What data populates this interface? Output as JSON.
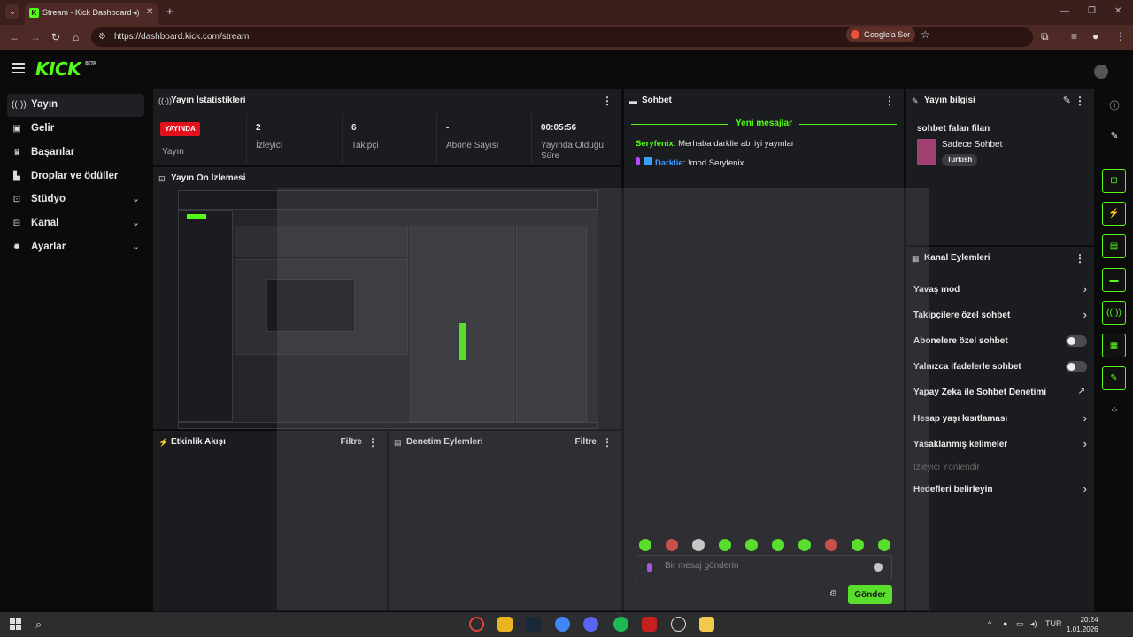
{
  "browser": {
    "tab_title": "Stream - Kick Dashboard",
    "url": "https://dashboard.kick.com/stream",
    "google_ask": "Google'a Sor"
  },
  "header": {
    "logo": "KICK",
    "logo_badge": "BETA"
  },
  "sidebar": {
    "items": [
      {
        "label": "Yayın",
        "icon": "broadcast-icon"
      },
      {
        "label": "Gelir",
        "icon": "revenue-icon"
      },
      {
        "label": "Başarılar",
        "icon": "trophy-icon"
      },
      {
        "label": "Droplar ve ödüller",
        "icon": "drops-icon"
      },
      {
        "label": "Stüdyo",
        "icon": "studio-icon"
      },
      {
        "label": "Kanal",
        "icon": "channel-icon"
      },
      {
        "label": "Ayarlar",
        "icon": "gear-icon"
      }
    ]
  },
  "stats": {
    "title": "Yayın İstatistikleri",
    "live_badge": "YAYINDA",
    "stream_label": "Yayın",
    "viewers_value": "2",
    "viewers_label": "İzleyici",
    "followers_value": "6",
    "followers_label": "Takipçi",
    "subs_value": "-",
    "subs_label": "Abone Sayısı",
    "duration_value": "00:05:56",
    "duration_label": "Yayında Olduğu Süre"
  },
  "preview": {
    "title": "Yayın Ön İzlemesi"
  },
  "activity": {
    "title": "Etkinlik Akışı",
    "filter": "Filtre"
  },
  "moderation": {
    "title": "Denetim Eylemleri",
    "filter": "Filtre"
  },
  "chat": {
    "title": "Sohbet",
    "new_messages": "Yeni mesajlar",
    "messages": [
      {
        "user": "Seryfenix",
        "user_color": "#53fc18",
        "text": "Merhaba darklie abi iyi yayınlar"
      },
      {
        "user": "Darklie",
        "user_color": "#3c9cff",
        "text": "!mod Seryfenix"
      }
    ],
    "input_placeholder": "Bir mesaj gönderin",
    "send": "Gönder"
  },
  "stream_info": {
    "title": "Yayın bilgisi",
    "stream_title": "sohbet falan filan",
    "category": "Sadece Sohbet",
    "tag": "Turkish"
  },
  "channel_actions": {
    "title": "Kanal Eylemleri",
    "rows": [
      {
        "label": "Yavaş mod",
        "control": "chevron"
      },
      {
        "label": "Takipçilere özel sohbet",
        "control": "chevron"
      },
      {
        "label": "Abonelere özel sohbet",
        "control": "toggle",
        "value": false
      },
      {
        "label": "Yalnızca ifadelerle sohbet",
        "control": "toggle",
        "value": false
      },
      {
        "label": "Yapay Zeka ile Sohbet Denetimi",
        "control": "external"
      },
      {
        "label": "Hesap yaşı kısıtlaması",
        "control": "chevron"
      },
      {
        "label": "Yasaklanmış kelimeler",
        "control": "chevron"
      },
      {
        "label": "İzleyici Yönlendir",
        "control": "none",
        "disabled": true
      },
      {
        "label": "Hedefleri belirleyin",
        "control": "chevron"
      }
    ]
  },
  "taskbar": {
    "lang": "TUR",
    "time": "20:24",
    "date": "1.01.2026"
  },
  "colors": {
    "accent": "#53fc18",
    "live": "#e1121e",
    "panel": "#1b1c1f"
  }
}
